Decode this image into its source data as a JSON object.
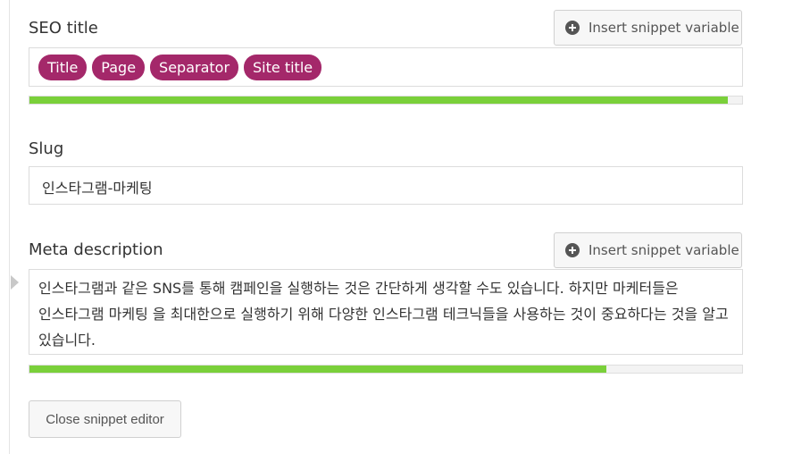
{
  "seo_title": {
    "label": "SEO title",
    "insert_button_label": "Insert snippet variable",
    "variables": [
      "Title",
      "Page",
      "Separator",
      "Site title"
    ],
    "progress": 0.98
  },
  "slug": {
    "label": "Slug",
    "value": "인스타그램-마케팅"
  },
  "meta_description": {
    "label": "Meta description",
    "insert_button_label": "Insert snippet variable",
    "value": "인스타그램과 같은 SNS를 통해 캠페인을 실행하는 것은 간단하게 생각할 수도 있습니다. 하지만 마케터들은 인스타그램 마케팅 을 최대한으로 실행하기 위해 다양한 인스타그램 테크닉들을 사용하는 것이 중요하다는 것을 알고 있습니다.",
    "progress": 0.81
  },
  "close_button_label": "Close snippet editor",
  "colors": {
    "chip": "#a4286a",
    "progress_good": "#7ad03a"
  }
}
